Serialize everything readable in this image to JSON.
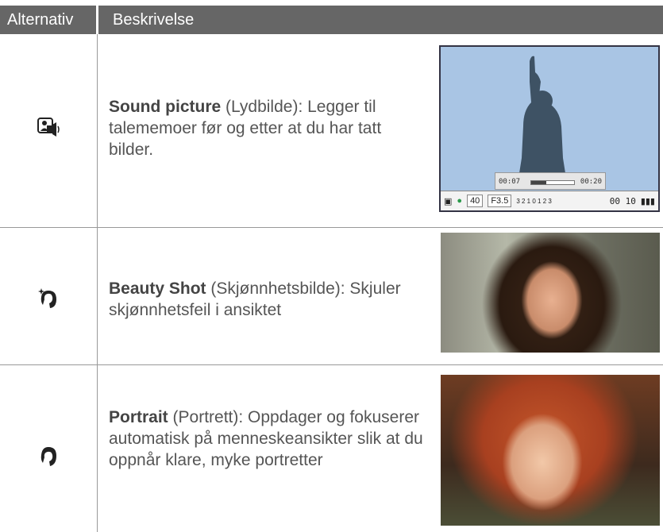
{
  "header": {
    "col1": "Alternativ",
    "col2": "Beskrivelse"
  },
  "rows": [
    {
      "icon": "sound-picture-icon",
      "title": "Sound picture",
      "rest": " (Lydbilde): Legger til talememoer før og etter at du har tatt bilder."
    },
    {
      "icon": "beauty-shot-icon",
      "title": "Beauty Shot",
      "rest": " (Skjønnhetsbilde): Skjuler skjønnhetsfeil i ansiktet"
    },
    {
      "icon": "portrait-icon",
      "title": "Portrait",
      "rest": " (Portrett): Oppdager og fokuserer automatisk på menneskeansikter slik at du oppnår klare, myke portretter"
    }
  ],
  "camera_screen": {
    "time_start": "00:07",
    "time_end": "00:20",
    "iso": "40",
    "aperture": "F3.5",
    "ev_scale": "3 2 1 0 1 2 3",
    "counter": "00 10",
    "playback_progress": 0.35
  }
}
